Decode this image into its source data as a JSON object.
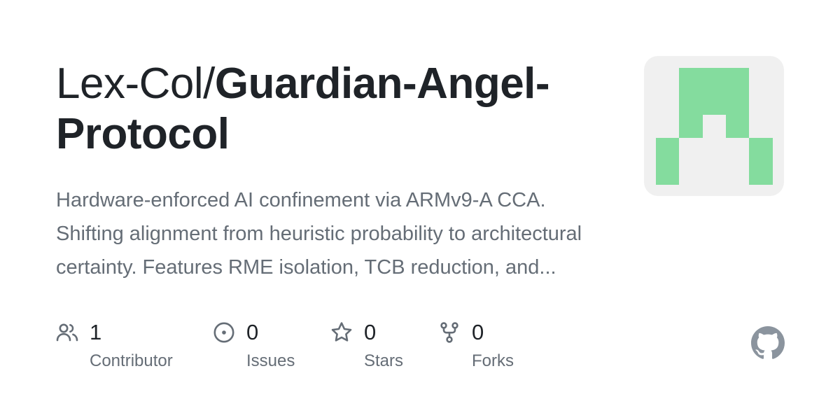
{
  "repo": {
    "owner_prefix": "Lex-Col/",
    "name_line1": "Guardian-Angel-",
    "name_line2": "Protocol",
    "description": "Hardware-enforced AI confinement via ARMv9-A CCA. Shifting alignment from heuristic probability to architectural certainty. Features RME isolation, TCB reduction, and..."
  },
  "avatar": {
    "color": "#84dc9e",
    "background": "#f0f0f0",
    "icon": "identicon"
  },
  "stats": [
    {
      "icon": "people-icon",
      "value": "1",
      "label": "Contributor"
    },
    {
      "icon": "issue-icon",
      "value": "0",
      "label": "Issues"
    },
    {
      "icon": "star-icon",
      "value": "0",
      "label": "Stars"
    },
    {
      "icon": "fork-icon",
      "value": "0",
      "label": "Forks"
    }
  ],
  "brand": {
    "icon": "github-logo-icon",
    "color": "#8b949e"
  },
  "colors": {
    "heading": "#1f2328",
    "muted": "#656d76",
    "icon": "#656d76"
  }
}
